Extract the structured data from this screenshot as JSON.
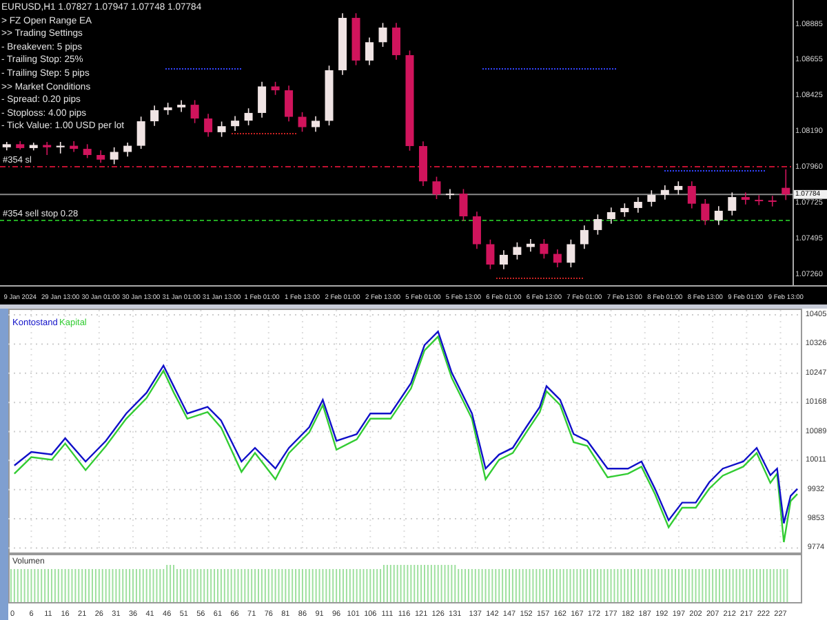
{
  "price_chart": {
    "info_lines": [
      "EURUSD,H1  1.07827 1.07947 1.07748 1.07784",
      "> FZ Open Range EA",
      ">> Trading Settings",
      "- Breakeven: 5 pips",
      "- Trailing Stop: 25%",
      "- Trailing Step: 5 pips",
      ">> Market Conditions",
      "- Spread: 0.20 pips",
      "- Stoploss: 4.00 pips",
      "- Tick Value: 1.00 USD per lot"
    ],
    "current_price": "1.07784",
    "order_lines": [
      {
        "label": "#354 sl",
        "kind": "stoploss"
      },
      {
        "label": "#354 sell stop 0.28",
        "kind": "pending"
      }
    ],
    "chart_data": {
      "type": "candlestick",
      "categories": [
        null,
        "9 Jan 2024",
        null,
        null,
        "29 Jan 13:00",
        null,
        null,
        "30 Jan 01:00",
        null,
        null,
        "30 Jan 13:00",
        null,
        null,
        "31 Jan 01:00",
        null,
        null,
        "31 Jan 13:00",
        null,
        null,
        "1 Feb 01:00",
        null,
        null,
        "1 Feb 13:00",
        null,
        null,
        "2 Feb 01:00",
        null,
        null,
        "2 Feb 13:00",
        null,
        null,
        "5 Feb 01:00",
        null,
        null,
        "5 Feb 13:00",
        null,
        null,
        "6 Feb 01:00",
        null,
        null,
        "6 Feb 13:00",
        null,
        null,
        "7 Feb 01:00",
        null,
        null,
        "7 Feb 13:00",
        null,
        null,
        "8 Feb 01:00",
        null,
        null,
        "8 Feb 13:00",
        null,
        null,
        "9 Feb 01:00",
        null,
        null,
        "9 Feb 13:00"
      ],
      "ohlc": [
        [
          1.0809,
          1.08125,
          1.0807,
          1.0811
        ],
        [
          1.0811,
          1.0813,
          1.08075,
          1.08085
        ],
        [
          1.08085,
          1.0812,
          1.0807,
          1.08105
        ],
        [
          1.08105,
          1.08125,
          1.0804,
          1.0809
        ],
        [
          1.0809,
          1.08125,
          1.0805,
          1.081
        ],
        [
          1.081,
          1.0813,
          1.0806,
          1.0808
        ],
        [
          1.0808,
          1.0811,
          1.0802,
          1.0804
        ],
        [
          1.0804,
          1.0807,
          1.0799,
          1.0801
        ],
        [
          1.0801,
          1.0809,
          1.0798,
          1.0806
        ],
        [
          1.0806,
          1.0812,
          1.0803,
          1.081
        ],
        [
          1.081,
          1.08289,
          1.0808,
          1.08259
        ],
        [
          1.08259,
          1.08361,
          1.08229,
          1.08331
        ],
        [
          1.08331,
          1.08379,
          1.08301,
          1.08349
        ],
        [
          1.08349,
          1.08396,
          1.08319,
          1.08366
        ],
        [
          1.08366,
          1.08396,
          1.08247,
          1.08277
        ],
        [
          1.08277,
          1.08307,
          1.08158,
          1.08188
        ],
        [
          1.08188,
          1.08257,
          1.08158,
          1.08227
        ],
        [
          1.08227,
          1.08293,
          1.08197,
          1.08263
        ],
        [
          1.08263,
          1.08343,
          1.08233,
          1.08313
        ],
        [
          1.08313,
          1.08515,
          1.08283,
          1.08485
        ],
        [
          1.08485,
          1.08515,
          1.0843,
          1.0846
        ],
        [
          1.0846,
          1.0849,
          1.08258,
          1.08288
        ],
        [
          1.08288,
          1.08318,
          1.08191,
          1.08221
        ],
        [
          1.08221,
          1.08292,
          1.08191,
          1.08262
        ],
        [
          1.08262,
          1.0862,
          1.08232,
          1.0859
        ],
        [
          1.0859,
          1.0896,
          1.0856,
          1.0893
        ],
        [
          1.0893,
          1.0896,
          1.08623,
          1.08653
        ],
        [
          1.08653,
          1.08802,
          1.08623,
          1.08772
        ],
        [
          1.08772,
          1.08897,
          1.08742,
          1.08867
        ],
        [
          1.08867,
          1.08897,
          1.08658,
          1.08688
        ],
        [
          1.08688,
          1.08718,
          1.08068,
          1.08098
        ],
        [
          1.08098,
          1.08128,
          1.07839,
          1.07869
        ],
        [
          1.07869,
          1.07899,
          1.07754,
          1.07784
        ],
        [
          1.07784,
          1.07819,
          1.07754,
          1.07789
        ],
        [
          1.07789,
          1.07819,
          1.07612,
          1.07642
        ],
        [
          1.07642,
          1.07672,
          1.07431,
          1.07461
        ],
        [
          1.07461,
          1.07491,
          1.07299,
          1.07329
        ],
        [
          1.07329,
          1.07422,
          1.07299,
          1.07392
        ],
        [
          1.07392,
          1.07473,
          1.07362,
          1.07443
        ],
        [
          1.07443,
          1.07494,
          1.07413,
          1.07464
        ],
        [
          1.07464,
          1.07494,
          1.07368,
          1.07398
        ],
        [
          1.07398,
          1.07428,
          1.07311,
          1.07341
        ],
        [
          1.07341,
          1.07491,
          1.07311,
          1.07461
        ],
        [
          1.07461,
          1.07583,
          1.07431,
          1.07553
        ],
        [
          1.07553,
          1.07654,
          1.07523,
          1.07624
        ],
        [
          1.07624,
          1.07699,
          1.07594,
          1.07669
        ],
        [
          1.07669,
          1.07726,
          1.07639,
          1.07696
        ],
        [
          1.07696,
          1.07766,
          1.07666,
          1.07736
        ],
        [
          1.07736,
          1.07811,
          1.07706,
          1.07781
        ],
        [
          1.07781,
          1.07843,
          1.07751,
          1.07813
        ],
        [
          1.07813,
          1.07869,
          1.07783,
          1.07839
        ],
        [
          1.07839,
          1.07869,
          1.07694,
          1.07724
        ],
        [
          1.07724,
          1.07754,
          1.07586,
          1.07616
        ],
        [
          1.07616,
          1.07708,
          1.07586,
          1.07678
        ],
        [
          1.07678,
          1.07797,
          1.07648,
          1.07767
        ],
        [
          1.07767,
          1.07797,
          1.07719,
          1.07749
        ],
        [
          1.07749,
          1.07779,
          1.07715,
          1.07745
        ],
        [
          1.07745,
          1.07775,
          1.07706,
          1.07736
        ],
        [
          1.07827,
          1.07947,
          1.07748,
          1.07784
        ]
      ],
      "ylim": [
        1.07195,
        1.09046
      ],
      "yticks": [
        {
          "value": 1.08885,
          "label": "1.08885"
        },
        {
          "value": 1.08655,
          "label": "1.08655"
        },
        {
          "value": 1.08425,
          "label": "1.08425"
        },
        {
          "value": 1.0819,
          "label": "1.08190"
        },
        {
          "value": 1.0796,
          "label": "1.07960"
        },
        {
          "value": 1.07725,
          "label": "1.07725"
        },
        {
          "value": 1.07495,
          "label": "1.07495"
        },
        {
          "value": 1.0726,
          "label": "1.07260"
        }
      ]
    }
  },
  "equity_chart": {
    "chart_data": {
      "type": "line",
      "x": [
        1,
        6,
        12,
        16,
        22,
        28,
        34,
        40,
        45,
        48,
        52,
        58,
        62,
        68,
        72,
        78,
        82,
        88,
        92,
        96,
        102,
        106,
        112,
        118,
        122,
        126,
        130,
        136,
        140,
        144,
        148,
        152,
        156,
        158,
        162,
        166,
        170,
        176,
        182,
        186,
        190,
        194,
        198,
        202,
        206,
        210,
        216,
        220,
        224,
        226,
        228,
        230,
        232
      ],
      "series": [
        {
          "name": "Kontostand",
          "color": "#1010c8",
          "values": [
            9997,
            10034,
            10027,
            10071,
            10008,
            10064,
            10138,
            10194,
            10268,
            10212,
            10138,
            10156,
            10119,
            10008,
            10045,
            9989,
            10045,
            10101,
            10175,
            10064,
            10082,
            10138,
            10138,
            10220,
            10323,
            10360,
            10249,
            10138,
            9989,
            10027,
            10045,
            10101,
            10156,
            10212,
            10175,
            10082,
            10064,
            9989,
            9989,
            10008,
            9934,
            9849,
            9897,
            9897,
            9952,
            9989,
            10008,
            10045,
            9971,
            9989,
            9841,
            9915,
            9934
          ]
        },
        {
          "name": "Kapital",
          "color": "#33cc33",
          "values": [
            9975,
            10020,
            10013,
            10057,
            9985,
            10050,
            10124,
            10180,
            10254,
            10195,
            10124,
            10142,
            10100,
            9980,
            10031,
            9960,
            10031,
            10087,
            10161,
            10040,
            10068,
            10124,
            10124,
            10206,
            10309,
            10346,
            10235,
            10124,
            9960,
            10013,
            10031,
            10087,
            10142,
            10198,
            10161,
            10060,
            10050,
            9965,
            9975,
            9994,
            9920,
            9830,
            9883,
            9883,
            9935,
            9970,
            9994,
            10031,
            9950,
            9975,
            9790,
            9901,
            9920
          ]
        }
      ],
      "xlim": [
        -0.8,
        233
      ],
      "ylim": [
        9760,
        10420
      ],
      "grid": true,
      "yticks": [
        {
          "value": 10405,
          "label": "10405"
        },
        {
          "value": 10326,
          "label": "10326"
        },
        {
          "value": 10247,
          "label": "10247"
        },
        {
          "value": 10168,
          "label": "10168"
        },
        {
          "value": 10089,
          "label": "10089"
        },
        {
          "value": 10011,
          "label": "10011"
        },
        {
          "value": 9932,
          "label": "9932"
        },
        {
          "value": 9853,
          "label": "9853"
        },
        {
          "value": 9774,
          "label": "9774"
        }
      ],
      "xticks": [
        0,
        6,
        11,
        16,
        21,
        26,
        31,
        36,
        41,
        46,
        51,
        56,
        61,
        66,
        71,
        76,
        81,
        86,
        91,
        96,
        101,
        106,
        111,
        116,
        121,
        126,
        131,
        137,
        142,
        147,
        152,
        157,
        162,
        167,
        172,
        177,
        182,
        187,
        192,
        197,
        202,
        207,
        212,
        217,
        222,
        227
      ]
    },
    "volume_label": "Volumen"
  }
}
